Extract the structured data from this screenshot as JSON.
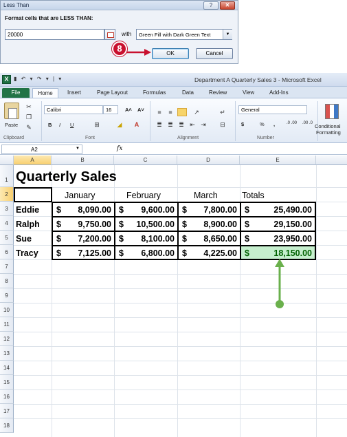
{
  "dialog": {
    "title": "Less Than",
    "help_label": "?",
    "close_label": "✕",
    "prompt": "Format cells that are LESS THAN:",
    "value": "20000",
    "with_label": "with",
    "format_option": "Green Fill with Dark Green Text",
    "ok_label": "OK",
    "cancel_label": "Cancel"
  },
  "callout": {
    "step": "8"
  },
  "excel": {
    "window_title": "Department A Quarterly Sales 3  -  Microsoft Excel",
    "qat": "▮ ↶ ▾ ↷ ▾ | ▾",
    "tabs": [
      "File",
      "Home",
      "Insert",
      "Page Layout",
      "Formulas",
      "Data",
      "Review",
      "View",
      "Add-Ins"
    ],
    "ribbon": {
      "paste_label": "Paste",
      "font_name": "Calibri",
      "font_size": "16",
      "number_format": "General",
      "conditional_label_1": "Conditional",
      "conditional_label_2": "Formatting",
      "groups": [
        "Clipboard",
        "Font",
        "Alignment",
        "Number"
      ],
      "bold": "B",
      "italic": "I",
      "underline": "U",
      "grow": "A˄",
      "shrink": "A˅",
      "currency": "$",
      "percent": "%",
      "comma": ",",
      "inc_dec": ".0 .00",
      "dec_dec": ".00 .0"
    },
    "name_box": "A2",
    "fx": "fx",
    "columns": [
      "A",
      "B",
      "C",
      "D",
      "E"
    ],
    "rows": [
      "1",
      "2",
      "3",
      "4",
      "5",
      "6",
      "7",
      "8",
      "9",
      "10",
      "11",
      "12",
      "13",
      "14",
      "15",
      "16",
      "17",
      "18"
    ],
    "sheet": {
      "title": "Quarterly Sales",
      "headers": [
        "January",
        "February",
        "March",
        "Totals"
      ],
      "data": [
        {
          "name": "Eddie",
          "values": [
            "8,090.00",
            "9,600.00",
            "7,800.00",
            "25,490.00"
          ]
        },
        {
          "name": "Ralph",
          "values": [
            "9,750.00",
            "10,500.00",
            "8,900.00",
            "29,150.00"
          ]
        },
        {
          "name": "Sue",
          "values": [
            "7,200.00",
            "8,100.00",
            "8,650.00",
            "23,950.00"
          ]
        },
        {
          "name": "Tracy",
          "values": [
            "7,125.00",
            "6,800.00",
            "4,225.00",
            "18,150.00"
          ]
        }
      ],
      "currency_symbol": "$"
    },
    "highlight_colors": {
      "fill": "#c6efce",
      "text": "#006100"
    }
  }
}
